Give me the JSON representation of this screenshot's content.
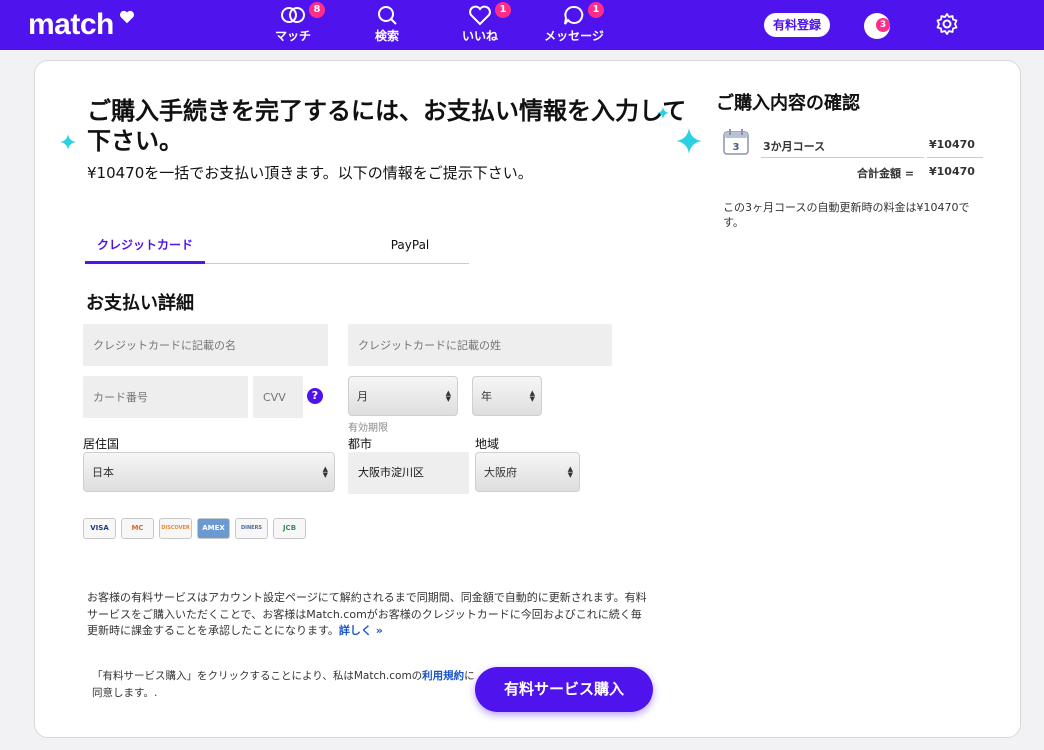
{
  "header": {
    "logo": "match",
    "nav": [
      {
        "label": "マッチ",
        "badge": "8"
      },
      {
        "label": "検索",
        "badge": ""
      },
      {
        "label": "いいね",
        "badge": "1"
      },
      {
        "label": "メッセージ",
        "badge": "1"
      }
    ],
    "register_label": "有料登録",
    "avatar_badge": "3"
  },
  "main": {
    "heading": "ご購入手続きを完了するには、お支払い情報を入力して下さい。",
    "subheading": "¥10470を一括でお支払い頂きます。以下の情報をご提示下さい。",
    "tabs": [
      "クレジットカード",
      "PayPal"
    ],
    "section_title": "お支払い詳細",
    "fields": {
      "first_name_placeholder": "クレジットカードに記載の名",
      "last_name_placeholder": "クレジットカードに記載の姓",
      "card_number_placeholder": "カード番号",
      "cvv_placeholder": "CVV",
      "month_value": "月",
      "year_value": "年",
      "expiry_label": "有効期限",
      "country_label": "居住国",
      "country_value": "日本",
      "city_label": "都市",
      "city_value": "大阪市淀川区",
      "region_label": "地域",
      "region_value": "大阪府",
      "help_icon": "?"
    },
    "card_brands": [
      "VISA",
      "MC",
      "DISCOVER",
      "AMEX",
      "DINERS",
      "JCB"
    ],
    "legal_text": "お客様の有料サービスはアカウント設定ページにて解約されるまで同期間、同金額で自動的に更新されます。有料サービスをご購入いただくことで、お客様はMatch.comがお客様のクレジットカードに今回およびこれに続く毎更新時に課金することを承認したことになります。",
    "legal_link": "詳しく »",
    "agree_text_before": "「有料サービス購入」をクリックすることにより、私はMatch.comの",
    "agree_link": "利用規約",
    "agree_text_after": "に同意します。.",
    "buy_button": "有料サービス購入"
  },
  "summary": {
    "title": "ご購入内容の確認",
    "calendar_number": "3",
    "course_name": "3か月コース",
    "course_price": "¥10470",
    "total_label": "合計金額 =",
    "total_price": "¥10470",
    "renewal_note": "この3ヶ月コースの自動更新時の料金は¥10470です。"
  },
  "colors": {
    "brand": "#4f14ee",
    "badge": "#ff2d8a",
    "sparkle": "#2ad1e0"
  }
}
